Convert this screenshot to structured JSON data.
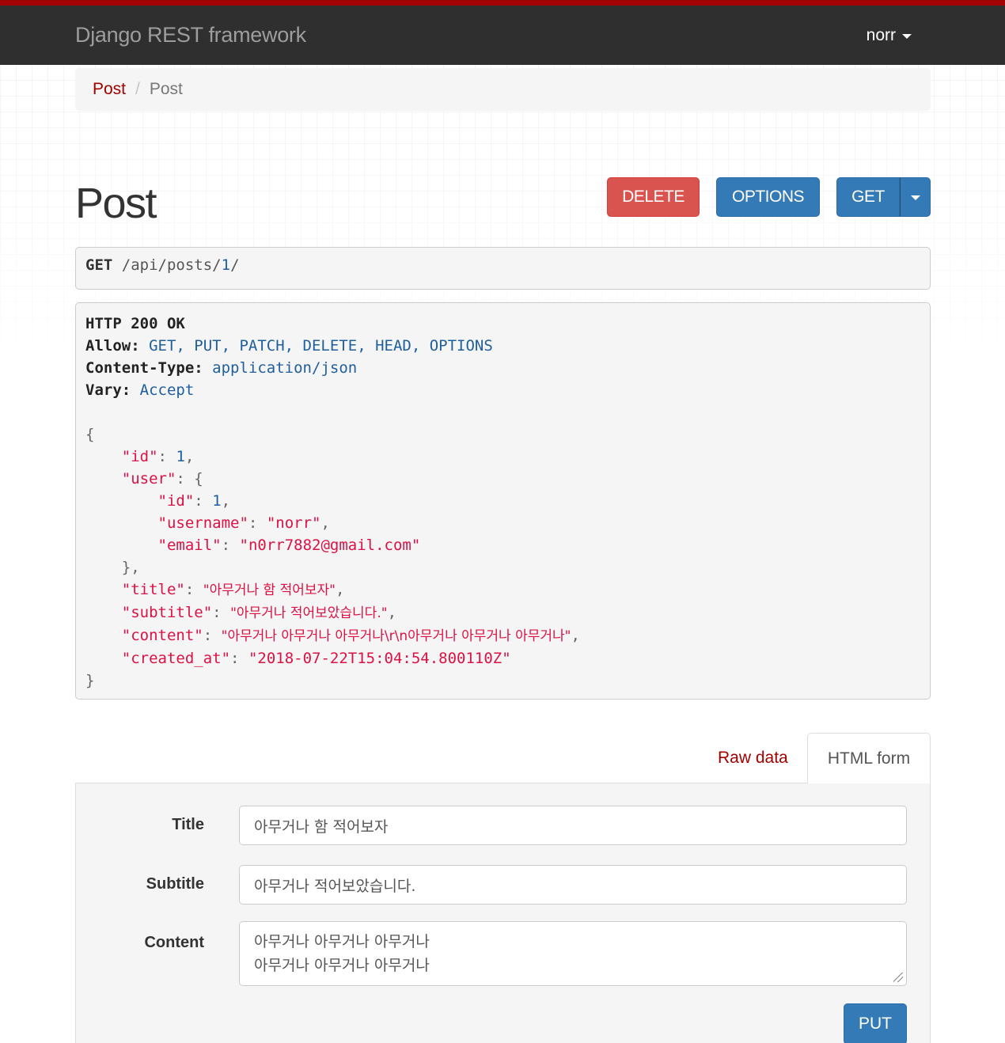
{
  "navbar": {
    "brand": "Django REST framework",
    "user": "norr",
    "accent_color": "#a30000"
  },
  "breadcrumb": [
    {
      "label": "Post",
      "active": false
    },
    {
      "label": "Post",
      "active": true
    }
  ],
  "page_title": "Post",
  "actions": {
    "delete_label": "DELETE",
    "options_label": "OPTIONS",
    "get_label": "GET"
  },
  "request": {
    "method": "GET",
    "path_prefix": "/api/posts/",
    "path_id": "1",
    "path_suffix": "/"
  },
  "response": {
    "status_line": "HTTP 200 OK",
    "headers": [
      {
        "name": "Allow:",
        "value": "GET, PUT, PATCH, DELETE, HEAD, OPTIONS"
      },
      {
        "name": "Content-Type:",
        "value": "application/json"
      },
      {
        "name": "Vary:",
        "value": "Accept"
      }
    ],
    "body": {
      "id": "1",
      "user_id": "1",
      "username": "\"norr\"",
      "email": "\"n0rr7882@gmail.com\"",
      "title": "\"아무거나 함 적어보자\"",
      "subtitle": "\"아무거나 적어보았습니다.\"",
      "content": "\"아무거나 아무거나 아무거나\\r\\n아무거나 아무거나 아무거나\"",
      "created_at": "\"2018-07-22T15:04:54.800110Z\""
    }
  },
  "tabs": {
    "raw_label": "Raw data",
    "html_label": "HTML form",
    "active": "HTML form"
  },
  "form": {
    "title_label": "Title",
    "title_value": "아무거나 함 적어보자",
    "subtitle_label": "Subtitle",
    "subtitle_value": "아무거나 적어보았습니다.",
    "content_label": "Content",
    "content_line1": "아무거나 아무거나 아무거나",
    "content_line2": "아무거나 아무거나 아무거나",
    "submit_label": "PUT"
  }
}
